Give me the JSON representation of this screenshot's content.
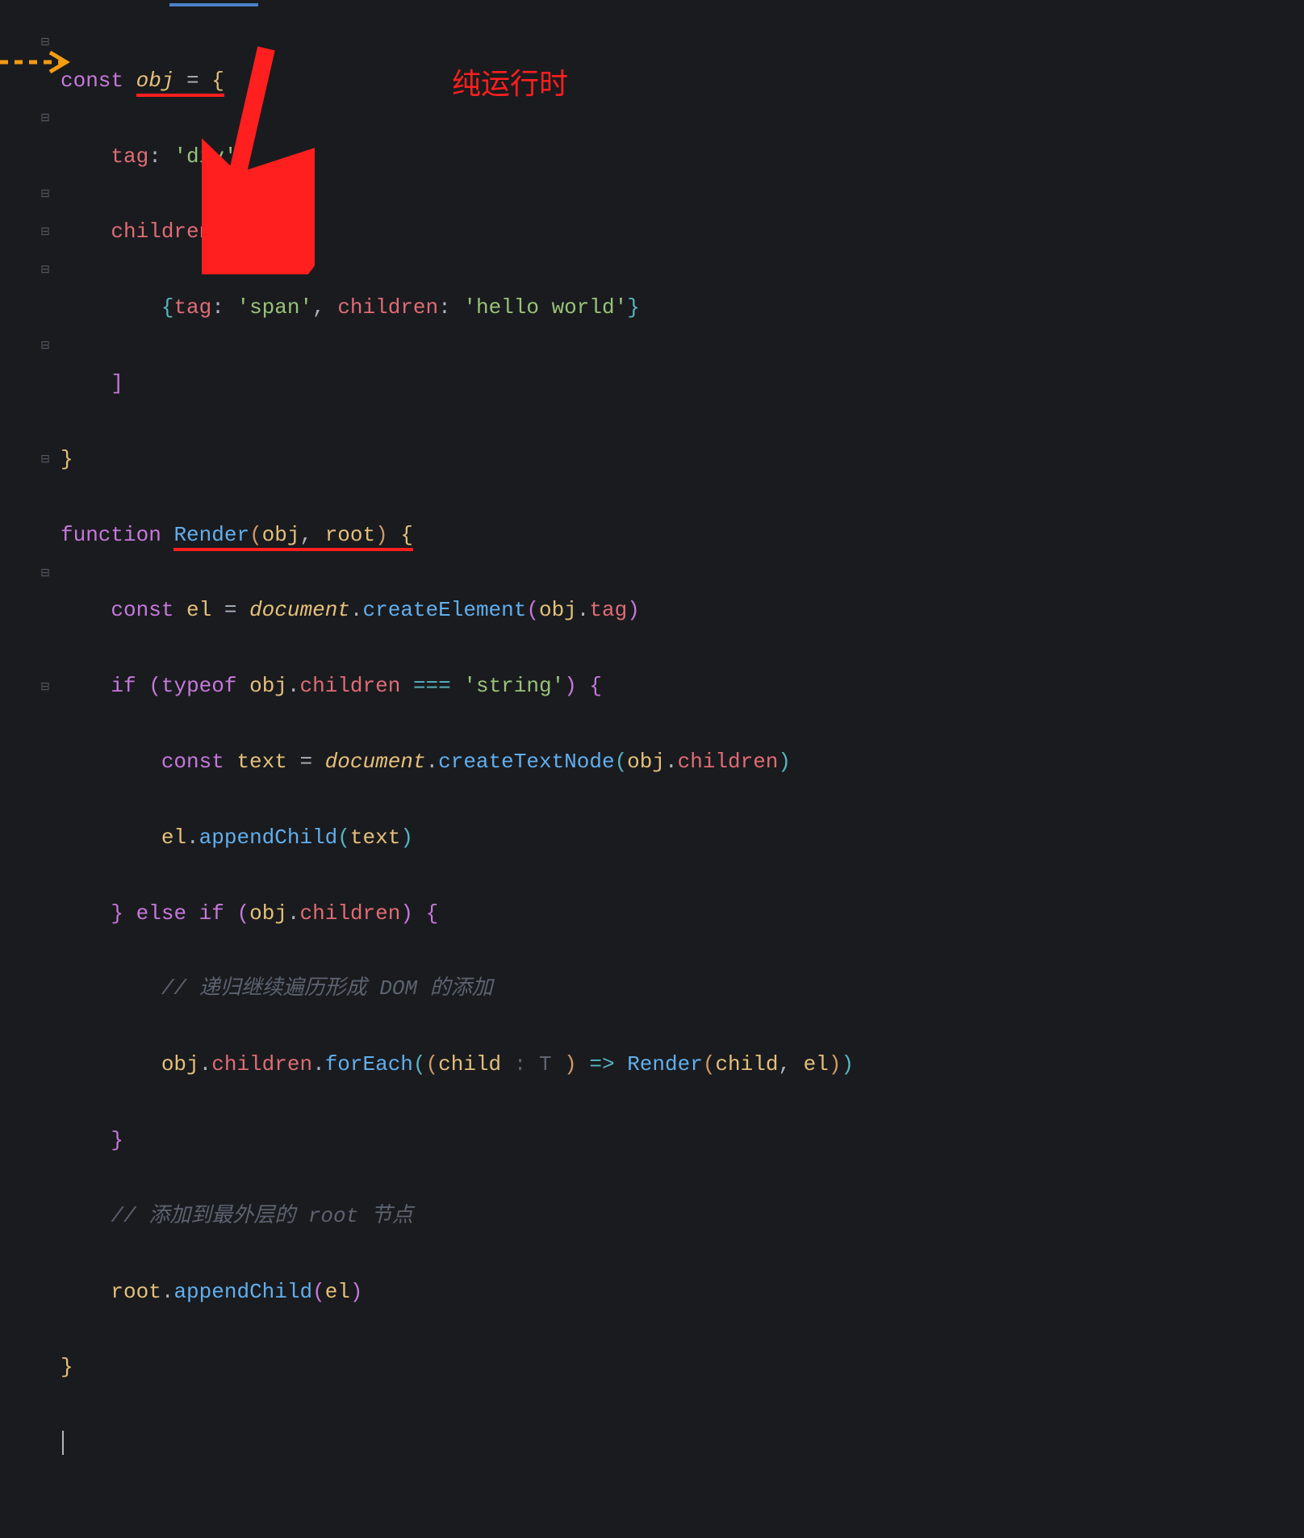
{
  "annotation": {
    "title": "纯运行时"
  },
  "code": {
    "l1": {
      "const": "const",
      "obj": "obj",
      "eq": " = ",
      "brace": "{"
    },
    "l2": {
      "key": "tag",
      "val": "'div'",
      "comma": ","
    },
    "l3": {
      "key": "children",
      "colon": ": ",
      "bracket": "["
    },
    "l4": {
      "brace": "{",
      "key1": "tag",
      "colon": ": ",
      "val1": "'span'",
      "comma": ", ",
      "key2": "children",
      "val2": "'hello world'",
      "cbrace": "}"
    },
    "l5": {
      "bracket": "]"
    },
    "l6": {
      "brace": "}"
    },
    "l7": {
      "fn_kw": "function",
      "name": "Render",
      "p1": "obj",
      "p2": "root",
      "brace": "{"
    },
    "l8": {
      "const": "const",
      "el": "el",
      "eq": " = ",
      "doc": "document",
      "dot1": ".",
      "ce": "createElement",
      "obj": "obj",
      "dot2": ".",
      "tag": "tag"
    },
    "l9": {
      "if": "if",
      "typeof": "typeof",
      "obj": "obj",
      "children": "children",
      "op": "===",
      "str": "'string'",
      "brace": "{"
    },
    "l10": {
      "const": "const",
      "text": "text",
      "eq": " = ",
      "doc": "document",
      "ctn": "createTextNode",
      "obj": "obj",
      "children": "children"
    },
    "l11": {
      "el": "el",
      "ac": "appendChild",
      "text": "text"
    },
    "l12": {
      "cbrace": "}",
      "else": "else",
      "if": "if",
      "obj": "obj",
      "children": "children",
      "brace": "{"
    },
    "l13": {
      "cmnt": "// 递归继续遍历形成 DOM 的添加"
    },
    "l14": {
      "obj": "obj",
      "children": "children",
      "fe": "forEach",
      "child": "child",
      "hint": " : T ",
      "arrow": "=>",
      "render": "Render",
      "p1": "child",
      "p2": "el"
    },
    "l15": {
      "brace": "}"
    },
    "l16": {
      "cmnt": "// 添加到最外层的 root 节点"
    },
    "l17": {
      "root": "root",
      "ac": "appendChild",
      "el": "el"
    },
    "l18": {
      "brace": "}"
    }
  }
}
